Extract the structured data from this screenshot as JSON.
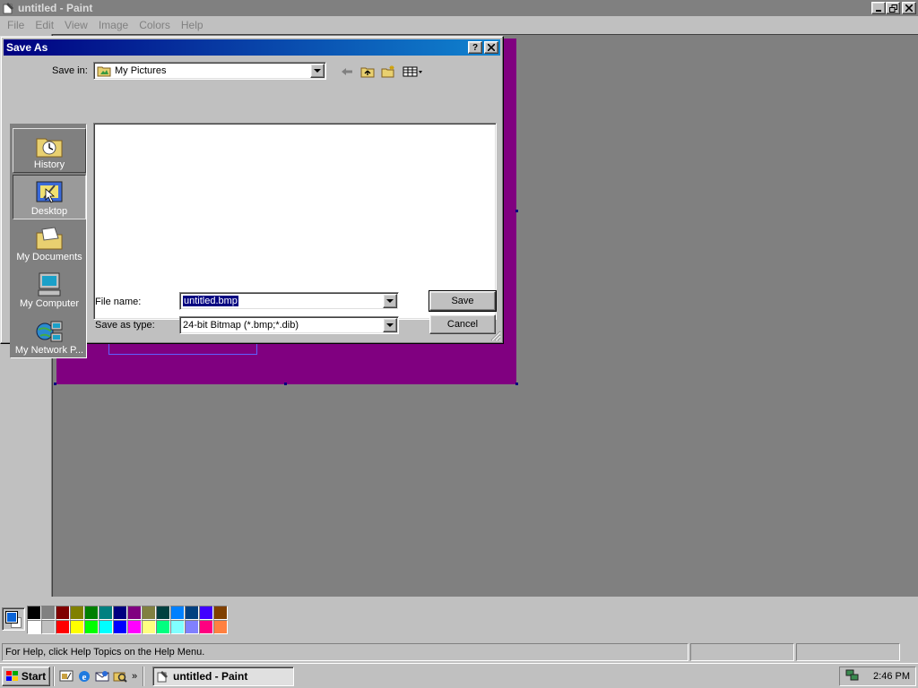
{
  "paint": {
    "title": "untitled - Paint",
    "menu": [
      "File",
      "Edit",
      "View",
      "Image",
      "Colors",
      "Help"
    ],
    "status_text": "For Help, click Help Topics on the Help Menu."
  },
  "palette": {
    "foreground": "#0a64d8",
    "background": "#ffffff",
    "row1": [
      "#000000",
      "#808080",
      "#800000",
      "#808000",
      "#008000",
      "#008080",
      "#000080",
      "#800080",
      "#808040",
      "#004040",
      "#0080ff",
      "#004080",
      "#4000ff",
      "#804000"
    ],
    "row2": [
      "#ffffff",
      "#c0c0c0",
      "#ff0000",
      "#ffff00",
      "#00ff00",
      "#00ffff",
      "#0000ff",
      "#ff00ff",
      "#ffff80",
      "#00ff80",
      "#80ffff",
      "#8080ff",
      "#ff0080",
      "#ff8040"
    ]
  },
  "canvas": {
    "image_color": "#800080"
  },
  "dialog": {
    "title": "Save As",
    "help_btn": "?",
    "close_btn": "✕",
    "save_in_label": "Save in:",
    "save_in_value": "My Pictures",
    "places": [
      {
        "label": "History",
        "icon": "history-icon"
      },
      {
        "label": "Desktop",
        "icon": "desktop-icon"
      },
      {
        "label": "My Documents",
        "icon": "my-documents-icon"
      },
      {
        "label": "My Computer",
        "icon": "my-computer-icon"
      },
      {
        "label": "My Network P...",
        "icon": "network-places-icon"
      }
    ],
    "file_name_label": "File name:",
    "file_name_value": "untitled.bmp",
    "save_type_label": "Save as type:",
    "save_type_value": "24-bit Bitmap (*.bmp;*.dib)",
    "save_button": "Save",
    "cancel_button": "Cancel"
  },
  "taskbar": {
    "start": "Start",
    "task": "untitled - Paint",
    "chevron": "»",
    "clock": "2:46 PM"
  }
}
